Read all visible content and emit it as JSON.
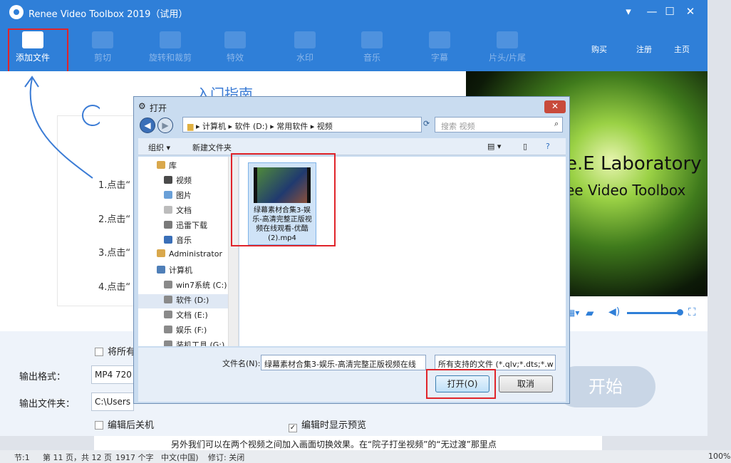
{
  "app": {
    "title": "Renee Video Toolbox 2019（试用）",
    "window_controls": [
      "▾",
      "—",
      "☐",
      "✕"
    ],
    "right_links": [
      "购买",
      "注册",
      "主页"
    ]
  },
  "toolbar": {
    "items": [
      "添加文件",
      "剪切",
      "旋转和裁剪",
      "特效",
      "水印",
      "音乐",
      "字幕",
      "片头/片尾"
    ]
  },
  "guide": {
    "heading": "入门指南",
    "steps": [
      "1.点击“",
      "2.点击“",
      "3.点击“",
      "4.点击“"
    ]
  },
  "preview": {
    "line1": "e.E Laboratory",
    "line2": "ee Video Toolbox"
  },
  "bottom": {
    "merge_label": "将所有",
    "format_label": "输出格式：",
    "format_value": "MP4 720",
    "folder_label": "输出文件夹：",
    "folder_value": "C:\\Users",
    "shutdown_label": "编辑后关机",
    "preview_label": "编辑时显示预览",
    "start_label": "开始"
  },
  "dialog": {
    "title": "打开",
    "breadcrumbs": [
      "计算机",
      "软件 (D:)",
      "常用软件",
      "视频"
    ],
    "search_placeholder": "搜索 视频",
    "organize": "组织 ▾",
    "new_folder": "新建文件夹",
    "tree": [
      "库",
      "视频",
      "图片",
      "文档",
      "迅雷下载",
      "音乐",
      "Administrator",
      "计算机",
      "win7系统 (C:)",
      "软件 (D:)",
      "文档 (E:)",
      "娱乐 (F:)",
      "装机工具 (G:)"
    ],
    "file_name": "绿幕素材合集3-娱乐-高清完整正版视频在线观看-优酷 (2).mp4",
    "filename_label": "文件名(N):",
    "filename_value": "绿幕素材合集3-娱乐-高清完整正版视频在线",
    "filter_value": "所有支持的文件 (*.qlv;*.dts;*.w",
    "open_button": "打开(O)",
    "cancel_button": "取消"
  },
  "status": {
    "section": "节:1",
    "page": "第 11 页，共 12 页",
    "words": "1917 个字",
    "lang": "中文(中国)",
    "revision": "修订: 关闭",
    "zoom": "100%",
    "doc_text": "另外我们可以在两个视频之间加入画面切换效果。在“院子打坐视频”的“无过渡”那里点"
  }
}
